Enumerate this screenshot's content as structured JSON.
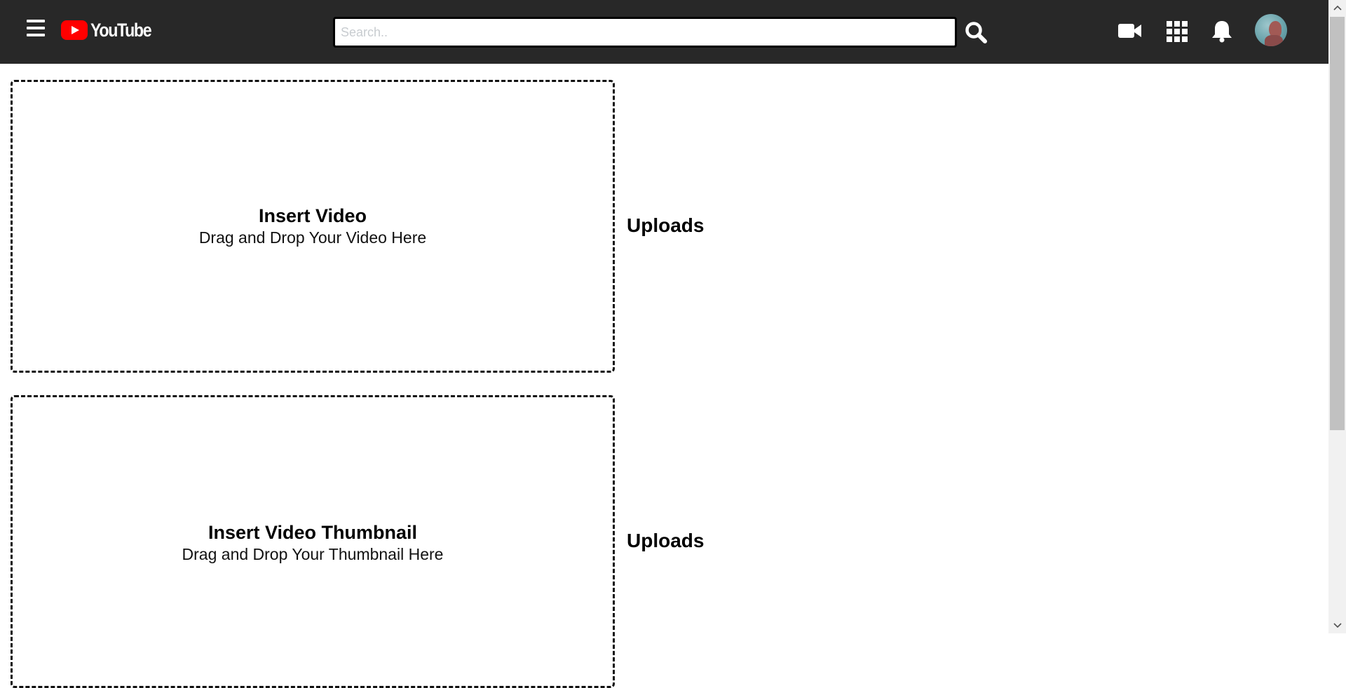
{
  "header": {
    "logo_text": "YouTube",
    "search": {
      "placeholder": "Search..",
      "value": ""
    },
    "icons": [
      "menu-icon",
      "search-icon",
      "video-camera-icon",
      "apps-grid-icon",
      "bell-icon",
      "avatar"
    ]
  },
  "upload_video": {
    "title": "Insert Video",
    "subtitle": "Drag and Drop Your Video Here",
    "uploads_label": "Uploads"
  },
  "upload_thumbnail": {
    "title": "Insert Video Thumbnail",
    "subtitle": "Drag and Drop Your Thumbnail Here",
    "uploads_label": "Uploads"
  },
  "colors": {
    "topbar": "#282828",
    "brand_red": "#ff0000",
    "background": "#ffffff"
  }
}
